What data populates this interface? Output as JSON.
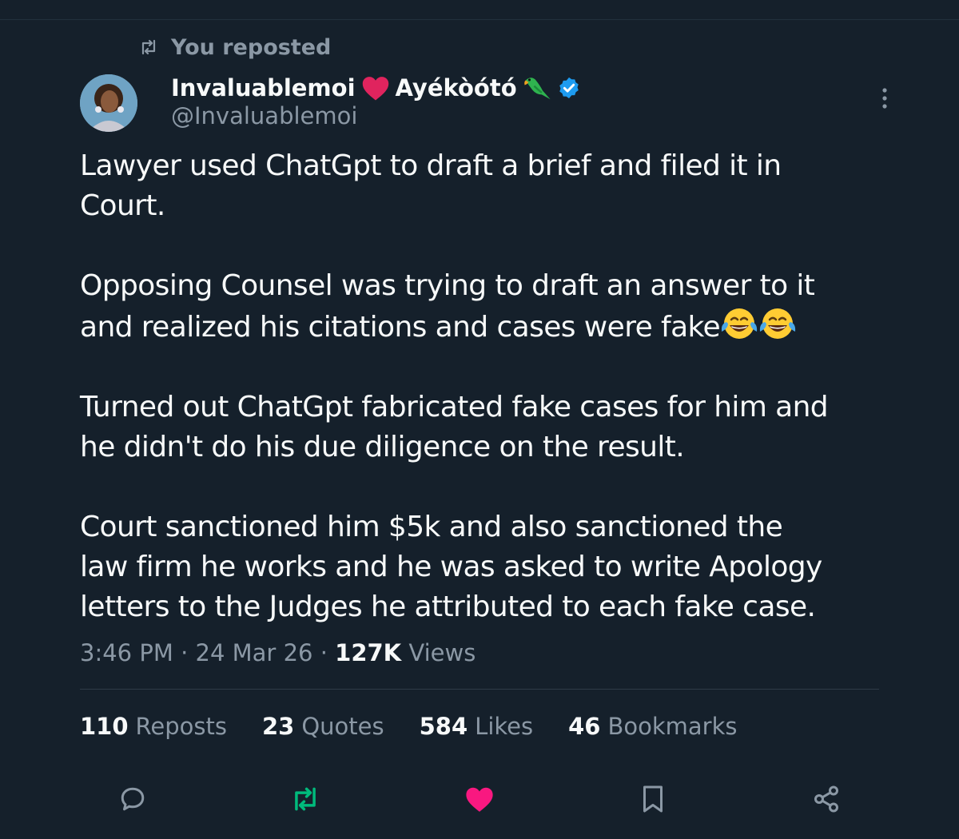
{
  "repost_banner": {
    "text": "You reposted",
    "icon": "repost-icon"
  },
  "author": {
    "display_name": "Invaluablemoi",
    "display_name_suffix": "Ayékòótó",
    "handle": "@Invaluablemoi",
    "verified": true,
    "verified_color": "#1d9bf0"
  },
  "tweet": {
    "paragraphs": [
      "Lawyer used ChatGpt to draft a brief and filed it in\nCourt.",
      "Opposing Counsel was trying to draft an answer to it\nand realized his citations and cases were fake",
      "Turned out ChatGpt fabricated fake cases for him and\nhe didn't do his due diligence on the result.",
      "Court sanctioned him $5k and also sanctioned the\nlaw firm he works and he was asked to write Apology\nletters to the Judges he attributed to each fake case."
    ]
  },
  "meta": {
    "time": "3:46 PM",
    "separator": " · ",
    "date": "24 Mar 26",
    "views_count": "127K",
    "views_label": "Views"
  },
  "stats": [
    {
      "count": "110",
      "label": "Reposts"
    },
    {
      "count": "23",
      "label": "Quotes"
    },
    {
      "count": "584",
      "label": "Likes"
    },
    {
      "count": "46",
      "label": "Bookmarks"
    }
  ],
  "colors": {
    "background": "#15202b",
    "text": "#f7f9f9",
    "secondary": "#8b98a5",
    "repost_active": "#00ba7c",
    "like_active": "#f91880"
  },
  "actions": [
    "reply-icon",
    "repost-icon",
    "like-icon",
    "bookmark-icon",
    "share-icon"
  ]
}
